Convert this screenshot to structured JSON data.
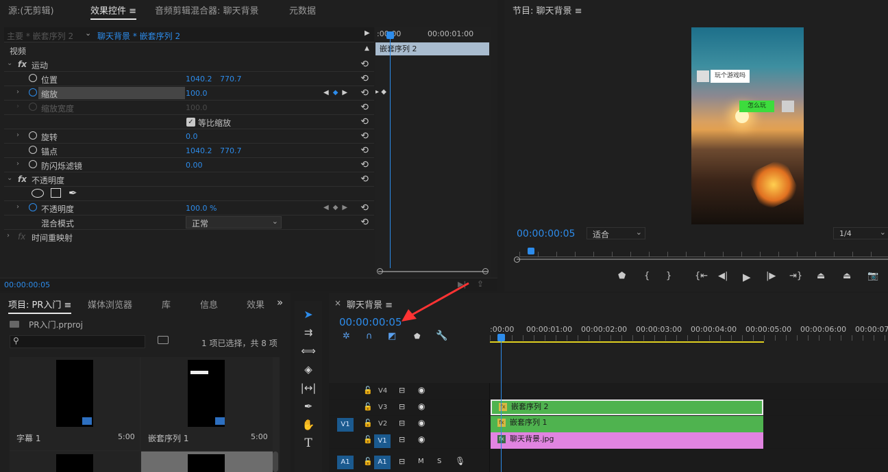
{
  "source_panel": {
    "tab_source": "源:(无剪辑)",
    "tab_effects": "效果控件",
    "tab_audio": "音频剪辑混合器: 聊天背景",
    "tab_meta": "元数据",
    "menu_icon": "≡"
  },
  "effects": {
    "master": "主要 * 嵌套序列 2",
    "clip": "聊天背景 * 嵌套序列 2",
    "section_video": "视频",
    "motion": "运动",
    "position_label": "位置",
    "position_x": "1040.2",
    "position_y": "770.7",
    "scale_label": "缩放",
    "scale_val": "100.0",
    "scale_width_label": "缩放宽度",
    "scale_width_val": "100.0",
    "uniform_label": "等比缩放",
    "rotation_label": "旋转",
    "rotation_val": "0.0",
    "anchor_label": "锚点",
    "anchor_x": "1040.2",
    "anchor_y": "770.7",
    "flicker_label": "防闪烁滤镜",
    "flicker_val": "0.00",
    "opacity_group": "不透明度",
    "opacity_label": "不透明度",
    "opacity_val": "100.0 %",
    "blend_label": "混合模式",
    "blend_val": "正常",
    "remap_label": "时间重映射",
    "timecode": "00:00:00:05",
    "ruler_start": ":00:00",
    "ruler_1": "00:00:01:00",
    "nested_clip": "嵌套序列 2",
    "fx": "fx"
  },
  "program": {
    "title": "节目: 聊天背景",
    "menu_icon": "≡",
    "timecode": "00:00:00:05",
    "fit": "适合",
    "quality": "1/4",
    "bubble_left": "玩个游戏吗",
    "bubble_right": "怎么玩"
  },
  "project": {
    "tab_project": "项目: PR入门",
    "tab_media": "媒体浏览器",
    "tab_lib": "库",
    "tab_info": "信息",
    "tab_effects": "效果",
    "more": "»",
    "menu_icon": "≡",
    "file": "PR入门.prproj",
    "selection": "1 项已选择，共 8 项",
    "items": [
      {
        "name": "字幕 1",
        "dur": "5:00"
      },
      {
        "name": "嵌套序列 1",
        "dur": "5:00"
      }
    ]
  },
  "timeline": {
    "close": "×",
    "title": "聊天背景",
    "menu_icon": "≡",
    "timecode": "00:00:00:05",
    "ruler": [
      ":00:00",
      "00:00:01:00",
      "00:00:02:00",
      "00:00:03:00",
      "00:00:04:00",
      "00:00:05:00",
      "00:00:06:00",
      "00:00:07:0"
    ],
    "tracks": {
      "v4": "V4",
      "v3": "V3",
      "v2": "V2",
      "v1": "V1",
      "a1": "A1",
      "src_v1": "V1",
      "src_a1": "A1",
      "m": "M",
      "s": "S"
    },
    "clips": {
      "v3": "嵌套序列 2",
      "v2": "嵌套序列 1",
      "v1": "聊天背景.jpg"
    }
  },
  "colors": {
    "accent": "#2d8ceb",
    "clip_green": "#4fb34f",
    "clip_pink": "#e184e1"
  }
}
